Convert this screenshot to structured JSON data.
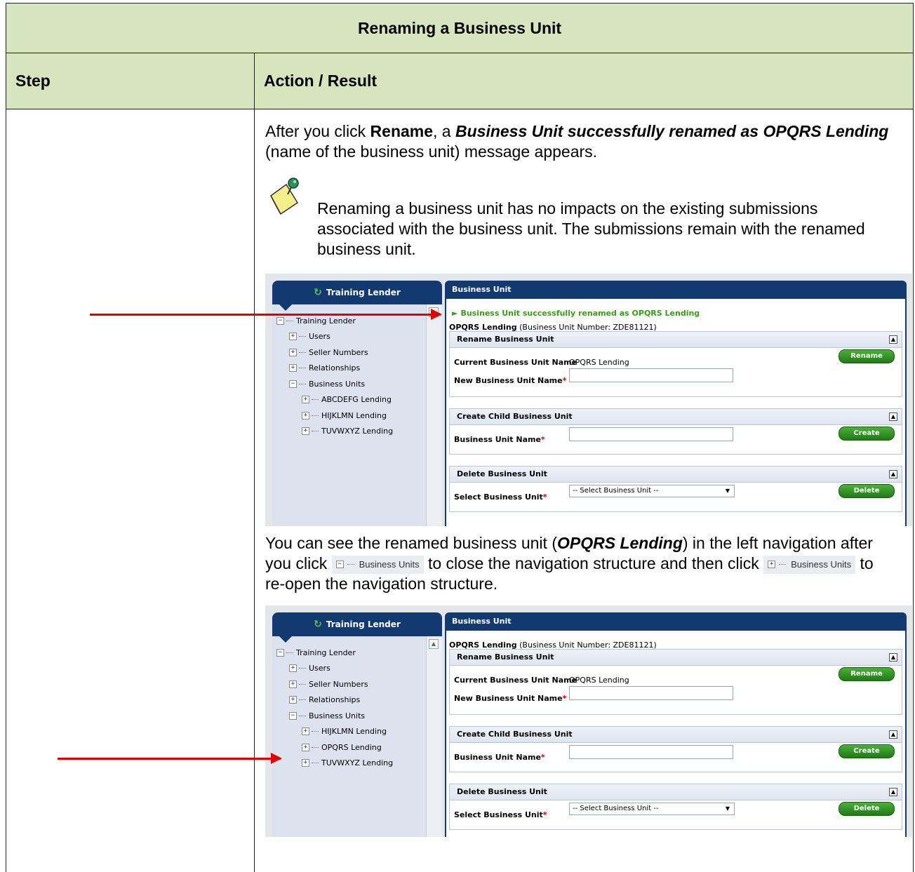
{
  "table": {
    "title": "Renaming a Business Unit",
    "col_step": "Step",
    "col_action": "Action / Result"
  },
  "intro": {
    "p1_a": "After you click ",
    "p1_rename": "Rename",
    "p1_b": ", a ",
    "p1_msg": "Business Unit successfully renamed as OPQRS Lending",
    "p1_c": " (name of the business unit) message appears."
  },
  "note": {
    "text": "Renaming a business unit has no impacts on the existing submissions associated with the business unit.  The submissions remain with the renamed business unit.",
    "icon": "note-pushpin-icon"
  },
  "screen1": {
    "left_tab": "Training Lender",
    "tree": [
      "Training Lender",
      "Users",
      "Seller Numbers",
      "Relationships",
      "Business Units",
      "ABCDEFG Lending",
      "HIJKLMN Lending",
      "TUVWXYZ Lending"
    ],
    "panel_title": "Business Unit",
    "success": "Business Unit successfully renamed as OPQRS Lending",
    "unit_name": "OPQRS Lending",
    "unit_number": "(Business Unit Number: ZDE81121)",
    "rename_section": "Rename Business Unit",
    "current_label": "Current Business Unit Name",
    "current_value": "OPQRS Lending",
    "rename_btn": "Rename",
    "new_label": "New Business Unit Name",
    "create_section": "Create Child Business Unit",
    "bu_name_label": "Business Unit Name",
    "create_btn": "Create",
    "delete_section": "Delete Business Unit",
    "select_label": "Select Business Unit",
    "select_value": "-- Select Business Unit --",
    "delete_btn": "Delete",
    "required_mark": "*"
  },
  "para2": {
    "a": "You can see the renamed business unit (",
    "b": "OPQRS Lending",
    "c": ") in the left navigation after you click ",
    "d": " to close the navigation structure and then click ",
    "e": " to re-open the navigation structure.",
    "btn_label": "Business Units"
  },
  "screen2": {
    "left_tab": "Training Lender",
    "tree": [
      "Training Lender",
      "Users",
      "Seller Numbers",
      "Relationships",
      "Business Units",
      "HIJKLMN Lending",
      "OPQRS Lending",
      "TUVWXYZ Lending"
    ],
    "panel_title": "Business Unit",
    "unit_name": "OPQRS Lending",
    "unit_number": "(Business Unit Number: ZDE81121)",
    "rename_section": "Rename Business Unit",
    "current_label": "Current Business Unit Name",
    "current_value": "OPQRS Lending",
    "rename_btn": "Rename",
    "new_label": "New Business Unit Name",
    "create_section": "Create Child Business Unit",
    "bu_name_label": "Business Unit Name",
    "create_btn": "Create",
    "delete_section": "Delete Business Unit",
    "select_label": "Select Business Unit",
    "select_value": "-- Select Business Unit --",
    "delete_btn": "Delete",
    "required_mark": "*"
  },
  "colors": {
    "header_bg": "#d6e5bd",
    "navy": "#123a70",
    "arrow": "#e00000",
    "success_green": "#3a9a1a"
  }
}
